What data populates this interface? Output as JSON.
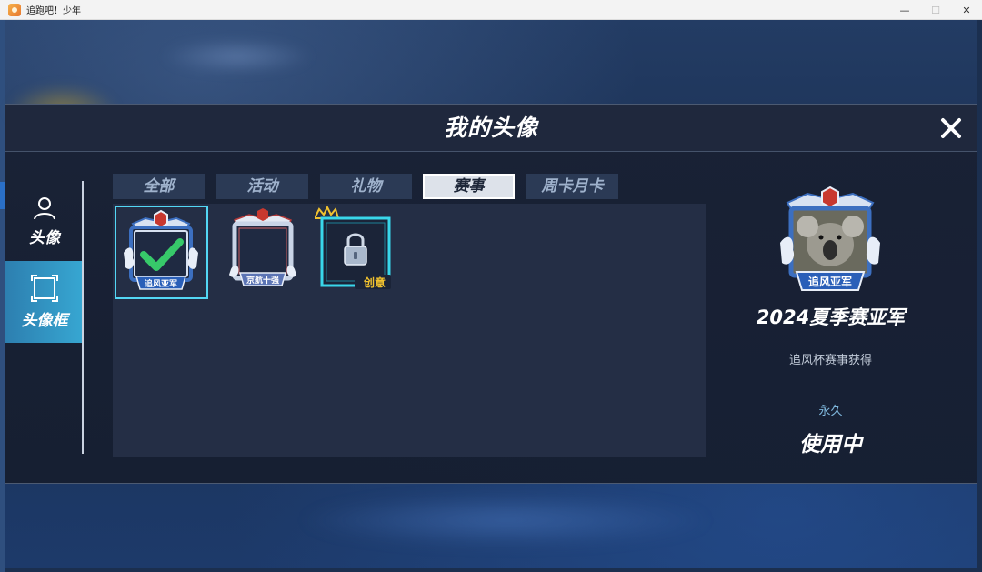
{
  "window": {
    "title": "追跑吧！少年",
    "minimize": "—",
    "maximize": "☐",
    "close": "✕"
  },
  "modal": {
    "title": "我的头像",
    "close_icon": "close-icon"
  },
  "sidebar": {
    "items": [
      {
        "label": "头像",
        "icon": "person-icon",
        "active": false
      },
      {
        "label": "头像框",
        "icon": "frame-icon",
        "active": true
      }
    ]
  },
  "tabs": [
    {
      "label": "全部",
      "active": false
    },
    {
      "label": "活动",
      "active": false
    },
    {
      "label": "礼物",
      "active": false
    },
    {
      "label": "赛事",
      "active": true
    },
    {
      "label": "周卡月卡",
      "active": false
    }
  ],
  "frames": [
    {
      "ribbon": "追风亚军",
      "equipped": true,
      "selected": true,
      "locked": false,
      "colors": {
        "body": "#3c6fc0",
        "ribbon": "#2a5fb8"
      }
    },
    {
      "ribbon": "京航十强",
      "equipped": false,
      "selected": false,
      "locked": false,
      "colors": {
        "body": "#c9d4e6",
        "ribbon": "#5b74b4"
      }
    },
    {
      "badge": "创意",
      "equipped": false,
      "selected": false,
      "locked": true,
      "colors": {
        "border": "#39d7ea",
        "badge": "#f1c22f"
      }
    }
  ],
  "detail": {
    "ribbon": "追风亚军",
    "name": "2024夏季赛亚军",
    "source": "追风杯赛事获得",
    "duration": "永久",
    "status": "使用中"
  },
  "colors": {
    "accent": "#37a7d2",
    "selected_border": "#53d7f4",
    "panel": "#242e45"
  }
}
